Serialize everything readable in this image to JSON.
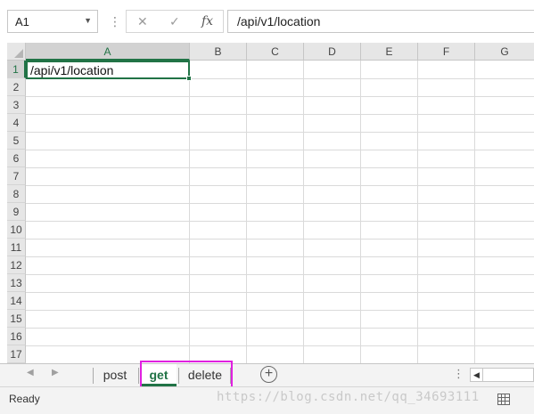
{
  "formula_bar": {
    "name_box": "A1",
    "cancel_icon": "✕",
    "enter_icon": "✓",
    "function_icon": "fx",
    "formula": "/api/v1/location"
  },
  "grid": {
    "columns": [
      "A",
      "B",
      "C",
      "D",
      "E",
      "F",
      "G"
    ],
    "rows": [
      "1",
      "2",
      "3",
      "4",
      "5",
      "6",
      "7",
      "8",
      "9",
      "10",
      "11",
      "12",
      "13",
      "14",
      "15",
      "16",
      "17"
    ],
    "selected_cell": "A1",
    "cell_a1": "/api/v1/location"
  },
  "sheets": {
    "tabs": [
      "post",
      "get",
      "delete"
    ],
    "active": "get",
    "add_label": "+"
  },
  "status": {
    "text": "Ready",
    "watermark": "https://blog.csdn.net/qq_34693111"
  },
  "colors": {
    "accent": "#217346",
    "highlight": "#e020e0"
  }
}
